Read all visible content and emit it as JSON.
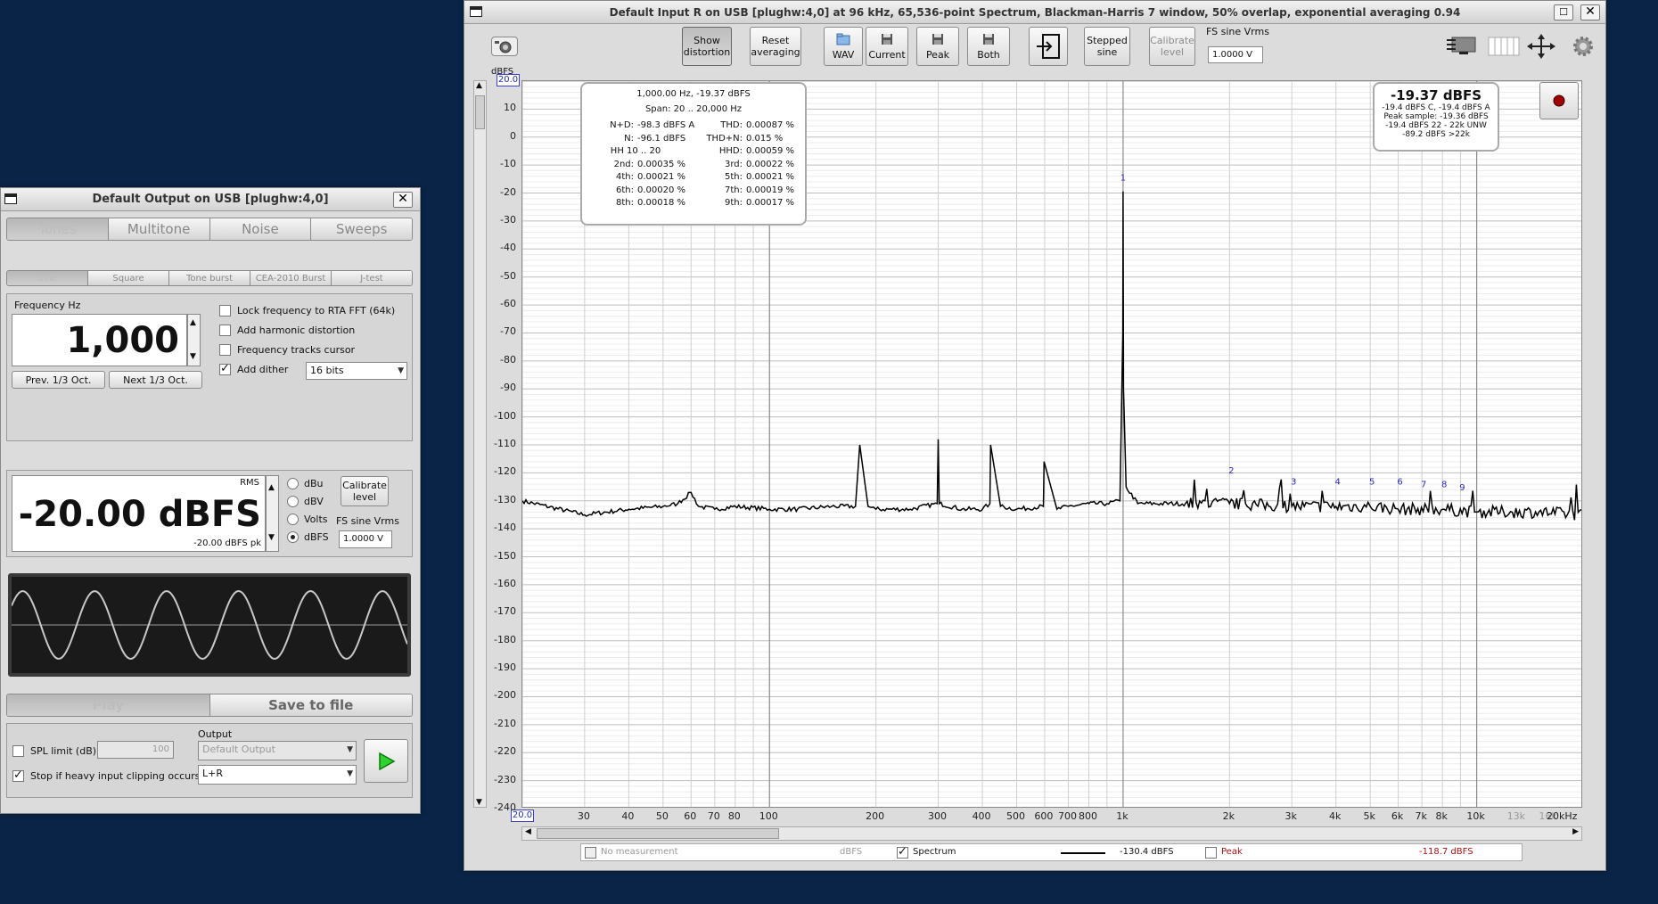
{
  "gen": {
    "title": "Default Output on USB [plughw:4,0]",
    "tabs": [
      "Tones",
      "Multitone",
      "Noise",
      "Sweeps"
    ],
    "subtabs": [
      "Sine",
      "Square",
      "Tone burst",
      "CEA-2010 Burst",
      "J-test"
    ],
    "freq_label": "Frequency Hz",
    "freq_value": "1,000",
    "prev_btn": "Prev. 1/3 Oct.",
    "next_btn": "Next 1/3 Oct.",
    "lock_label": "Lock frequency to RTA FFT (64k)",
    "harm_label": "Add harmonic distortion",
    "track_label": "Frequency tracks cursor",
    "dither_label": "Add dither",
    "dither_value": "16 bits",
    "rms_label": "RMS",
    "level_value": "-20.00 dBFS",
    "level_pk": "-20.00 dBFS pk",
    "units": [
      "dBu",
      "dBV",
      "Volts",
      "dBFS"
    ],
    "calibrate": "Calibrate level",
    "fs_label": "FS sine Vrms",
    "fs_value": "1.0000 V",
    "play": "Play",
    "save": "Save to file",
    "spl_label": "SPL limit (dB):",
    "spl_value": "100",
    "stop_label": "Stop if heavy input clipping occurs",
    "output_label": "Output",
    "output_device": "Default Output",
    "output_channel": "L+R"
  },
  "rta": {
    "title": "Default Input R on USB [plughw:4,0] at 96 kHz, 65,536-point Spectrum, Blackman-Harris 7 window, 50% overlap, exponential averaging 0.94",
    "toolbar": {
      "show_distortion": "Show distortion",
      "reset_averaging": "Reset averaging",
      "wav": "WAV",
      "current": "Current",
      "peak": "Peak",
      "both": "Both",
      "stepped_sine": "Stepped sine",
      "calibrate_level": "Calibrate level",
      "fs_label": "FS sine Vrms",
      "fs_value": "1.0000 V"
    },
    "y_unit": "dBFS",
    "y_top_box": "20.0",
    "x_left_box": "20.0",
    "y_ticks": [
      "10",
      "0",
      "-10",
      "-20",
      "-30",
      "-40",
      "-50",
      "-60",
      "-70",
      "-80",
      "-90",
      "-100",
      "-110",
      "-120",
      "-130",
      "-140",
      "-150",
      "-160",
      "-170",
      "-180",
      "-190",
      "-200",
      "-210",
      "-220",
      "-230",
      "-240"
    ],
    "x_ticks": [
      "30",
      "40",
      "50",
      "60",
      "70",
      "80",
      "100",
      "200",
      "300",
      "400",
      "500",
      "600",
      "700",
      "800",
      "1k",
      "2k",
      "3k",
      "4k",
      "5k",
      "6k",
      "7k",
      "8k",
      "10k",
      "13k",
      "16k",
      "20kHz"
    ],
    "dist": {
      "line1": "1,000.00 Hz, -19.37 dBFS",
      "span": "Span: 20 .. 20,000 Hz",
      "rows": [
        [
          "N+D:",
          "-98.3 dBFS A",
          "THD:",
          "0.00087 %"
        ],
        [
          "N:",
          "-96.1 dBFS",
          "THD+N:",
          "0.015 %"
        ],
        [
          "HH 10 .. 20",
          "",
          "HHD:",
          "0.00059 %"
        ],
        [
          "2nd:",
          "0.00035 %",
          "3rd:",
          "0.00022 %"
        ],
        [
          "4th:",
          "0.00021 %",
          "5th:",
          "0.00021 %"
        ],
        [
          "6th:",
          "0.00020 %",
          "7th:",
          "0.00019 %"
        ],
        [
          "8th:",
          "0.00018 %",
          "9th:",
          "0.00017 %"
        ]
      ]
    },
    "level_box": {
      "main": "-19.37 dBFS",
      "l1": "-19.4 dBFS C, -19.4 dBFS A",
      "l2": "Peak sample: -19.36 dBFS",
      "l3": "-19.4 dBFS 22 - 22k UNW",
      "l4": "-89.2 dBFS >22k"
    },
    "harmonic_labels": [
      "1",
      "2",
      "3",
      "4",
      "5",
      "6",
      "7",
      "8",
      "9"
    ],
    "legend": {
      "no_measurement": "No measurement",
      "unit": "dBFS",
      "spectrum": "Spectrum",
      "spectrum_val": "-130.4 dBFS",
      "peak": "Peak",
      "peak_val": "-118.7 dBFS"
    }
  },
  "chart_data": {
    "type": "line",
    "title": "",
    "xlabel": "",
    "ylabel": "dBFS",
    "x_scale": "log",
    "xlim": [
      20,
      20000
    ],
    "ylim": [
      -240,
      20
    ],
    "grid": true,
    "series": [
      {
        "name": "Spectrum",
        "color": "#000000",
        "x": [
          20,
          30,
          40,
          50,
          55,
          60,
          63,
          70,
          80,
          100,
          120,
          150,
          175,
          180,
          190,
          200,
          250,
          298,
          300,
          302,
          350,
          400,
          420,
          422,
          450,
          500,
          595,
          598,
          650,
          700,
          800,
          900,
          980,
          998,
          1000,
          1003,
          1020,
          1100,
          1500,
          2000,
          3000,
          4000,
          5000,
          6000,
          8000,
          10000,
          15000,
          20000
        ],
        "y": [
          -130,
          -135,
          -133,
          -132,
          -131,
          -127,
          -132,
          -133,
          -132,
          -133,
          -133,
          -132,
          -132,
          -110,
          -132,
          -133,
          -133,
          -131,
          -108,
          -131,
          -133,
          -133,
          -131,
          -110,
          -132,
          -133,
          -132,
          -116,
          -133,
          -132,
          -131,
          -131,
          -130,
          -70,
          -19.4,
          -90,
          -125,
          -131,
          -131,
          -131,
          -132,
          -132,
          -132,
          -133,
          -133,
          -134,
          -134,
          -135
        ]
      }
    ],
    "harmonics": [
      {
        "n": 1,
        "hz": 1000,
        "db": -19.4
      },
      {
        "n": 2,
        "hz": 2000,
        "db": -124
      },
      {
        "n": 3,
        "hz": 3000,
        "db": -128
      },
      {
        "n": 4,
        "hz": 4000,
        "db": -128
      },
      {
        "n": 5,
        "hz": 5000,
        "db": -128
      },
      {
        "n": 6,
        "hz": 6000,
        "db": -128
      },
      {
        "n": 7,
        "hz": 7000,
        "db": -129
      },
      {
        "n": 8,
        "hz": 8000,
        "db": -129
      },
      {
        "n": 9,
        "hz": 9000,
        "db": -130
      }
    ]
  }
}
